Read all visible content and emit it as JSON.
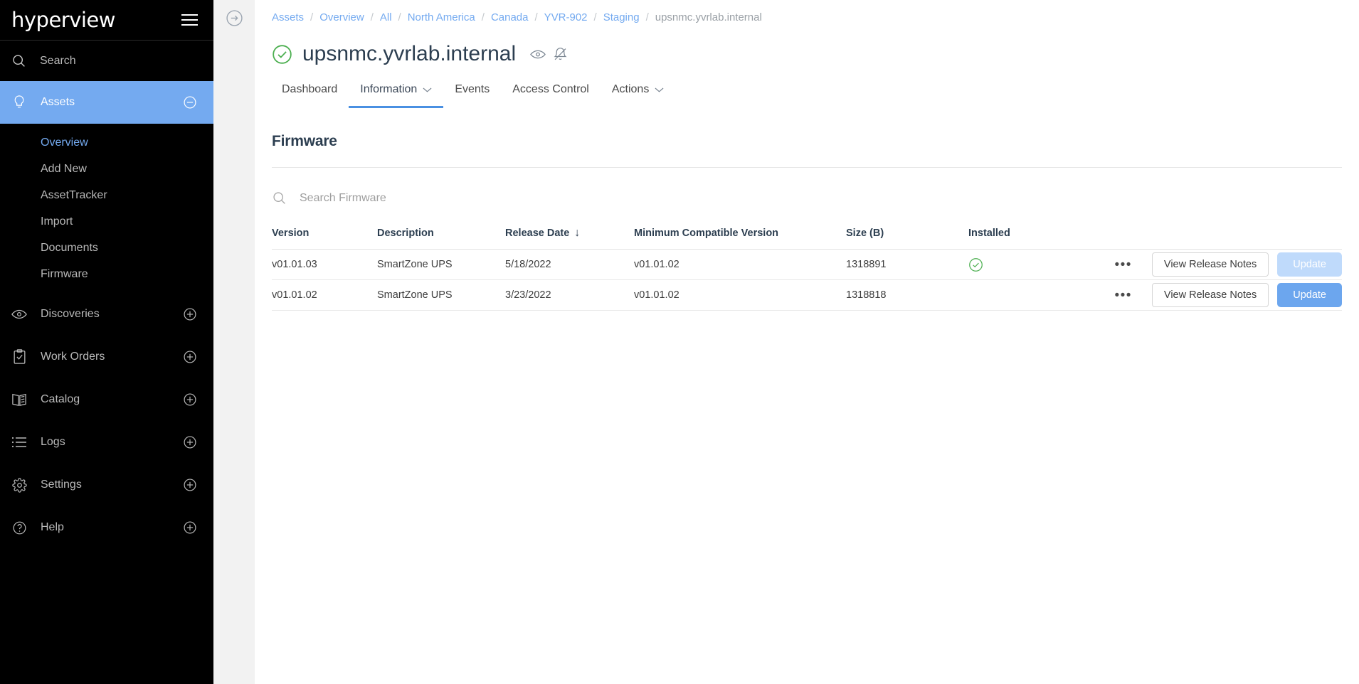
{
  "brand": {
    "name": "hyperview"
  },
  "sidebar": {
    "search_label": "Search",
    "items": [
      {
        "label": "Assets",
        "icon": "bulb-icon",
        "expander": "minus-circle-icon",
        "active": true
      },
      {
        "label": "Discoveries",
        "icon": "eye-icon",
        "expander": "plus-circle-icon",
        "active": false
      },
      {
        "label": "Work Orders",
        "icon": "clipboard-check-icon",
        "expander": "plus-circle-icon",
        "active": false
      },
      {
        "label": "Catalog",
        "icon": "book-icon",
        "expander": "plus-circle-icon",
        "active": false
      },
      {
        "label": "Logs",
        "icon": "list-icon",
        "expander": "plus-circle-icon",
        "active": false
      },
      {
        "label": "Settings",
        "icon": "gear-icon",
        "expander": "plus-circle-icon",
        "active": false
      },
      {
        "label": "Help",
        "icon": "question-circle-icon",
        "expander": "plus-circle-icon",
        "active": false
      }
    ],
    "assets_submenu": [
      {
        "label": "Overview",
        "selected": true
      },
      {
        "label": "Add New",
        "selected": false
      },
      {
        "label": "AssetTracker",
        "selected": false
      },
      {
        "label": "Import",
        "selected": false
      },
      {
        "label": "Documents",
        "selected": false
      },
      {
        "label": "Firmware",
        "selected": false
      }
    ]
  },
  "rail": {
    "expand_icon": "arrow-right-circle-icon"
  },
  "breadcrumb": {
    "links": [
      "Assets",
      "Overview",
      "All",
      "North America",
      "Canada",
      "YVR-902",
      "Staging"
    ],
    "current": "upsnmc.yvrlab.internal",
    "separator": "/"
  },
  "header": {
    "status_icon": "check-circle-icon",
    "title": "upsnmc.yvrlab.internal",
    "icons": [
      "eye-icon",
      "bell-muted-icon"
    ]
  },
  "tabs": [
    {
      "label": "Dashboard",
      "caret": false,
      "active": false
    },
    {
      "label": "Information",
      "caret": true,
      "active": true
    },
    {
      "label": "Events",
      "caret": false,
      "active": false
    },
    {
      "label": "Access Control",
      "caret": false,
      "active": false
    },
    {
      "label": "Actions",
      "caret": true,
      "active": false
    }
  ],
  "section": {
    "title": "Firmware",
    "search_placeholder": "Search Firmware",
    "search_value": "",
    "search_icon": "search-icon"
  },
  "table": {
    "columns": [
      {
        "key": "version",
        "label": "Version",
        "sorted": false
      },
      {
        "key": "description",
        "label": "Description",
        "sorted": false
      },
      {
        "key": "release_date",
        "label": "Release Date",
        "sorted": true,
        "sort_dir": "desc",
        "sort_glyph": "↓"
      },
      {
        "key": "min_compatible",
        "label": "Minimum Compatible Version",
        "sorted": false
      },
      {
        "key": "size",
        "label": "Size (B)",
        "sorted": false
      },
      {
        "key": "installed",
        "label": "Installed",
        "sorted": false
      }
    ],
    "rows": [
      {
        "version": "v01.01.03",
        "description": "SmartZone UPS",
        "release_date": "5/18/2022",
        "min_compatible": "v01.01.02",
        "size": "1318891",
        "installed": true,
        "installed_icon": "check-circle-icon",
        "menu_icon": "ellipsis-icon",
        "notes_label": "View Release Notes",
        "update_label": "Update",
        "update_disabled": true
      },
      {
        "version": "v01.01.02",
        "description": "SmartZone UPS",
        "release_date": "3/23/2022",
        "min_compatible": "v01.01.02",
        "size": "1318818",
        "installed": false,
        "installed_icon": "",
        "menu_icon": "ellipsis-icon",
        "notes_label": "View Release Notes",
        "update_label": "Update",
        "update_disabled": false
      }
    ]
  },
  "colors": {
    "sidebar_bg": "#000000",
    "accent_blue": "#74aaf0",
    "primary_button": "#6ca6ee",
    "primary_button_disabled": "#bfdafb",
    "status_green": "#4caf50",
    "text_dark": "#2c3e50"
  }
}
